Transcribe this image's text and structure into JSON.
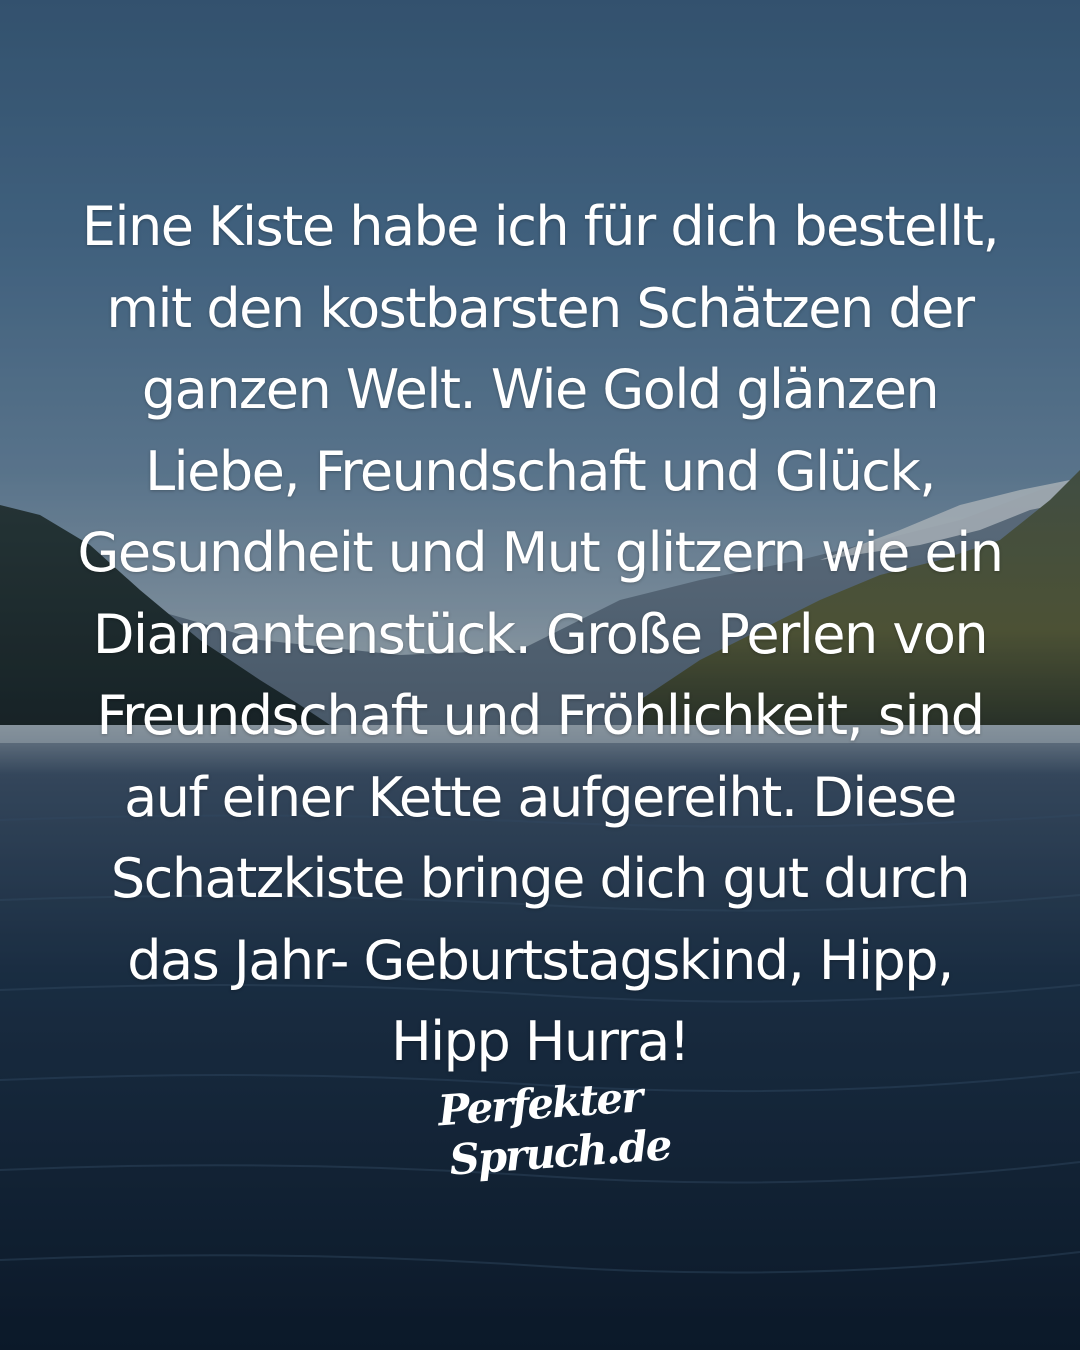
{
  "image": {
    "scene": "Mountain fjord lake at dusk",
    "quote_lines": [
      "Eine Kiste habe ich für dich bestellt,",
      "mit den kostbarsten Schätzen der",
      "ganzen Welt. Wie Gold glänzen",
      "Liebe, Freundschaft und Glück,",
      "Gesundheit und Mut glitzern wie ein",
      "Diamantenstück. Große Perlen von",
      "Freundschaft und Fröhlichkeit, sind",
      "auf einer Kette aufgereiht. Diese",
      "Schatzkiste bringe dich gut durch",
      "das Jahr- Geburtstagskind, Hipp,",
      "Hipp Hurra!"
    ],
    "logo": {
      "line1": "Perfekter",
      "line2": "Spruch.de"
    },
    "colors": {
      "text": "#ffffff",
      "sky_top": "#3c5f7f",
      "water": "#13253a"
    }
  }
}
